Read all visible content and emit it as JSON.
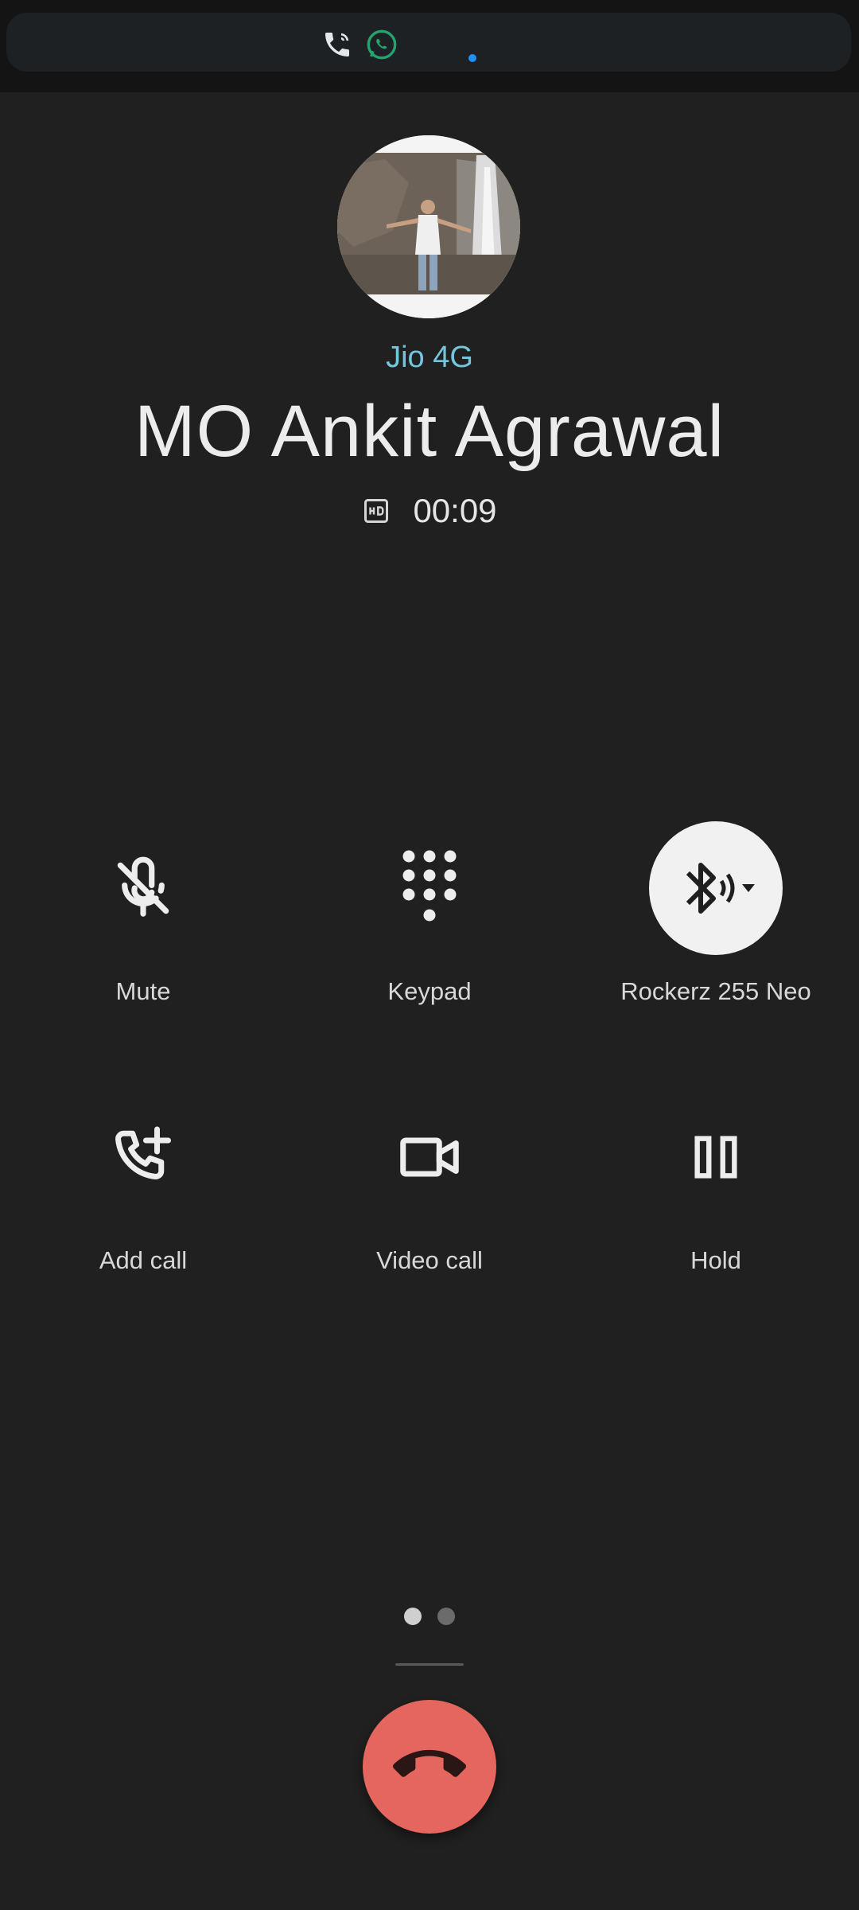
{
  "call": {
    "carrier": "Jio 4G",
    "caller_name": "MO Ankit Agrawal",
    "hd_icon": "hd-icon",
    "duration": "00:09"
  },
  "notification_bar": {
    "icons": [
      "wifi-calling-icon",
      "whatsapp-icon"
    ],
    "dot_color": "#1e90ff"
  },
  "controls": {
    "mute": {
      "label": "Mute",
      "icon": "mic-off-icon"
    },
    "keypad": {
      "label": "Keypad",
      "icon": "dialpad-icon"
    },
    "audio": {
      "label": "Rockerz 255 Neo",
      "icon": "bluetooth-audio-icon",
      "active": true
    },
    "add_call": {
      "label": "Add call",
      "icon": "add-call-icon"
    },
    "video_call": {
      "label": "Video call",
      "icon": "videocam-icon"
    },
    "hold": {
      "label": "Hold",
      "icon": "pause-icon"
    }
  },
  "pager": {
    "pages": 2,
    "current": 1
  },
  "end_call": {
    "icon": "call-end-icon",
    "color": "#e5655f"
  }
}
